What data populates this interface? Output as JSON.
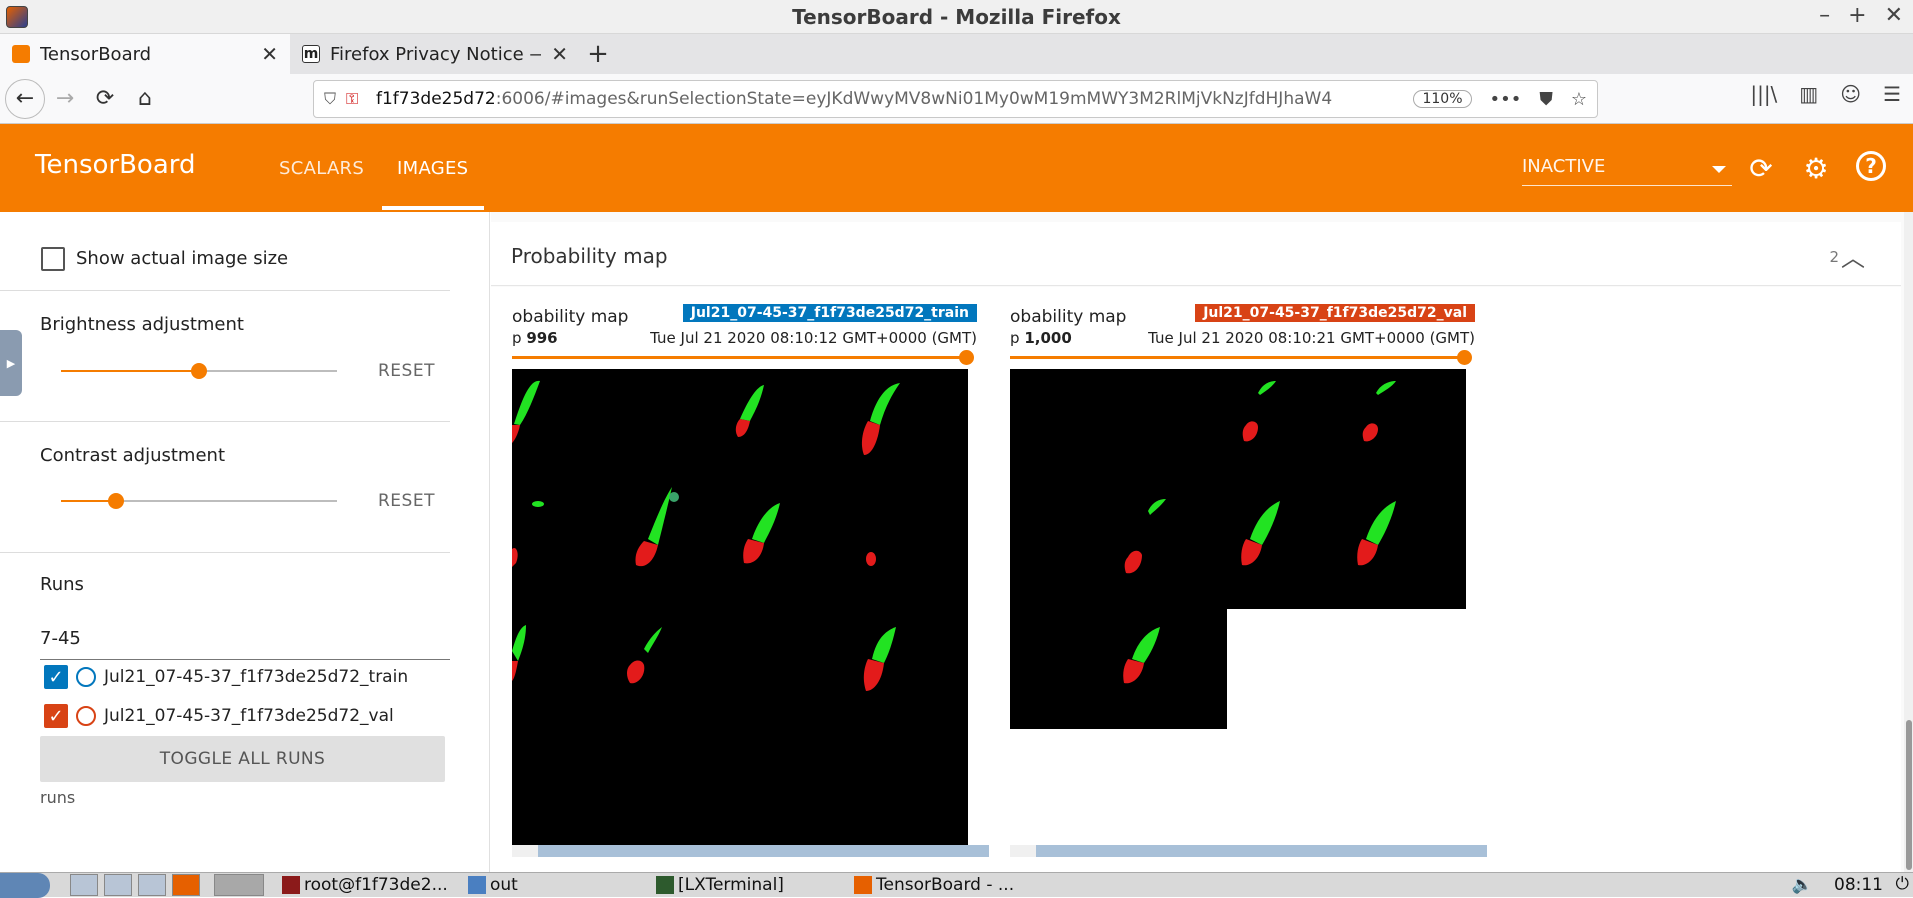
{
  "window": {
    "title": "TensorBoard - Mozilla Firefox",
    "controls": [
      "–",
      "+",
      "✕"
    ]
  },
  "tabs": [
    {
      "label": "TensorBoard",
      "active": true
    },
    {
      "label": "Firefox Privacy Notice —",
      "active": false
    }
  ],
  "urlbar": {
    "host": "f1f73de25d72",
    "rest": ":6006/#images&runSelectionState=eyJKdWwyMV8wNi01My0wM19mMWY3M2RlMjVkNzJfdHJhaW4",
    "zoom": "110%"
  },
  "header": {
    "brand": "TensorBoard",
    "tabs": [
      "SCALARS",
      "IMAGES"
    ],
    "active_tab": "IMAGES",
    "inactive_label": "INACTIVE",
    "accent": "#f57c00"
  },
  "sidebar": {
    "show_actual_size": "Show actual image size",
    "brightness_label": "Brightness adjustment",
    "brightness_value": 0.5,
    "contrast_label": "Contrast adjustment",
    "contrast_value": 0.2,
    "reset": "RESET",
    "runs_label": "Runs",
    "run_filter": "7-45",
    "runs": [
      {
        "name": "Jul21_07-45-37_f1f73de25d72_train",
        "color": "#0277bd",
        "checked": true
      },
      {
        "name": "Jul21_07-45-37_f1f73de25d72_val",
        "color": "#d84315",
        "checked": true
      }
    ],
    "toggle_all": "TOGGLE ALL RUNS",
    "footer": "runs"
  },
  "main": {
    "card_title": "Probability map",
    "card_count": "2",
    "images": [
      {
        "title": "obability map",
        "tag": "Jul21_07-45-37_f1f73de25d72_train",
        "tag_color": "#0277bd",
        "step_prefix": "p",
        "step": "996",
        "timestamp": "Tue Jul 21 2020 08:10:12 GMT+0000 (GMT)"
      },
      {
        "title": "obability map",
        "tag": "Jul21_07-45-37_f1f73de25d72_val",
        "tag_color": "#d84315",
        "step_prefix": "p",
        "step": "1,000",
        "timestamp": "Tue Jul 21 2020 08:10:21 GMT+0000 (GMT)"
      }
    ]
  },
  "taskbar": {
    "items": [
      "root@f1f73de2...",
      "out",
      "[LXTerminal]",
      "TensorBoard - ..."
    ],
    "clock": "08:11"
  }
}
